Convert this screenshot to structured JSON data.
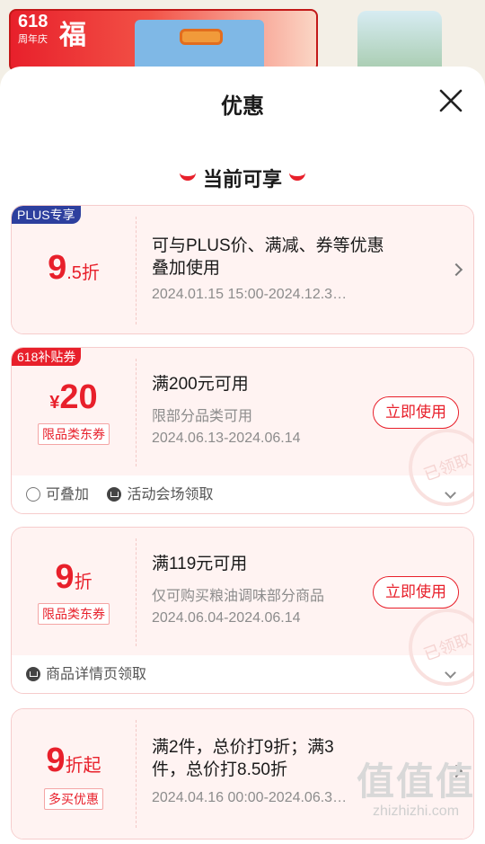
{
  "background": {
    "banner_label": "618",
    "banner_sub": "周年庆",
    "banner_glyph": "福"
  },
  "sheet": {
    "title": "优惠",
    "close_icon": "close-icon",
    "section_title": "当前可享"
  },
  "coupons": [
    {
      "tag": "PLUS专享",
      "value_main": "9",
      "value_sub": ".5折",
      "line1": "可与PLUS价、满减、券等优惠叠加使用",
      "line2": "",
      "date": "2024.01.15 15:00-2024.12.3…"
    },
    {
      "tag": "618补贴券",
      "currency": "¥",
      "value_main": "20",
      "pill": "限品类东券",
      "line1": "满200元可用",
      "line2": "限部分品类可用",
      "date": "2024.06.13-2024.06.14",
      "button": "立即使用",
      "stamp": "已领取",
      "footer_1": "可叠加",
      "footer_2": "活动会场领取"
    },
    {
      "value_main": "9",
      "value_sub": "折",
      "pill": "限品类东券",
      "line1": "满119元可用",
      "line2": "仅可购买粮油调味部分商品",
      "date": "2024.06.04-2024.06.14",
      "button": "立即使用",
      "stamp": "已领取",
      "footer_1": "商品详情页领取"
    },
    {
      "value_main": "9",
      "value_sub": "折起",
      "pill": "多买优惠",
      "line1": "满2件，总价打9折；满3件，总价打8.50折",
      "date": "2024.04.16 00:00-2024.06.3…"
    }
  ],
  "watermark": {
    "big": "值值值",
    "small": "zhizhizhi.com"
  },
  "colors": {
    "accent": "#e8202b",
    "plus_tag": "#2d3f9e",
    "card_bg": "#fff3f2"
  }
}
